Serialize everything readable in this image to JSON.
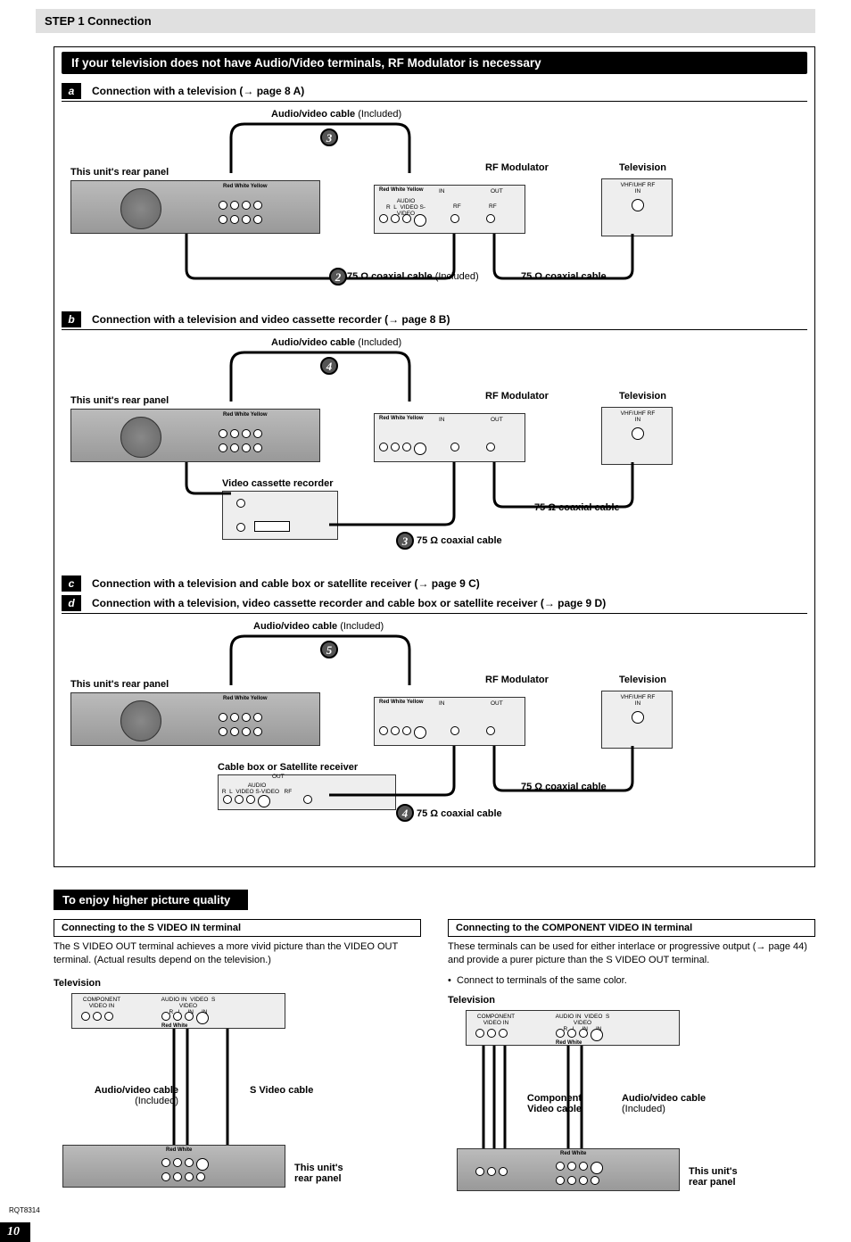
{
  "header": {
    "step": "STEP 1 Connection"
  },
  "bands": {
    "rf": "If your television does not have Audio/Video terminals, RF Modulator is necessary",
    "quality": "To enjoy higher picture quality"
  },
  "sections": {
    "a": {
      "letter": "a",
      "title": "Connection with a television (",
      "ref": "→ page 8 A",
      "close": ")"
    },
    "b": {
      "letter": "b",
      "title": "Connection with a television and video cassette recorder (",
      "ref": "→ page 8 B",
      "close": ")"
    },
    "c": {
      "letter": "c",
      "title": "Connection with a television and cable box or satellite receiver (",
      "ref": "→ page 9 C",
      "close": ")"
    },
    "d": {
      "letter": "d",
      "title": "Connection with a television, video cassette recorder and cable box or satellite receiver (",
      "ref": "→ page 9 D",
      "close": ")"
    }
  },
  "labels": {
    "av_cable": "Audio/video cable",
    "included": " (Included)",
    "rear": "This unit's rear panel",
    "rf_mod": "RF Modulator",
    "tv": "Television",
    "coax75": "75 Ω coaxial cable",
    "coax75_inc": " (Included)",
    "vcr": "Video cassette recorder",
    "satbox": "Cable box or Satellite receiver",
    "red_white_yellow": "Red White Yellow",
    "red_white": "Red White",
    "vhf": "VHF/UHF RF IN",
    "in": "IN",
    "out": "OUT",
    "audio_rl": "AUDIO",
    "r": "R",
    "l": "L",
    "video": "VIDEO",
    "svideo": "S-VIDEO",
    "rf": "RF",
    "comp_in": "COMPONENT VIDEO IN",
    "audio_in": "AUDIO IN",
    "video_in": "VIDEO IN",
    "svideo_in": "S VIDEO IN"
  },
  "steps": {
    "s2": "2",
    "s3": "3",
    "s4": "4",
    "s5": "5"
  },
  "quality": {
    "svideo": {
      "title": "Connecting to the S VIDEO IN terminal",
      "body": "The S VIDEO OUT terminal achieves a more vivid picture than the VIDEO OUT terminal. (Actual results depend on the television.)",
      "cable1": "Audio/video cable",
      "cable1_sub": "(Included)",
      "cable2": "S Video cable"
    },
    "component": {
      "title": "Connecting to the COMPONENT VIDEO IN terminal",
      "body1": "These terminals can be used for either interlace or progressive output (→ page 44) and provide a purer picture than the S VIDEO OUT terminal.",
      "bullet": "Connect to terminals of the same color.",
      "cable1": "Component Video cable",
      "cable2": "Audio/video cable",
      "cable2_sub": "(Included)"
    },
    "tv": "Television",
    "rear": "This unit's rear panel"
  },
  "footer": {
    "docid": "RQT8314",
    "page": "10"
  }
}
